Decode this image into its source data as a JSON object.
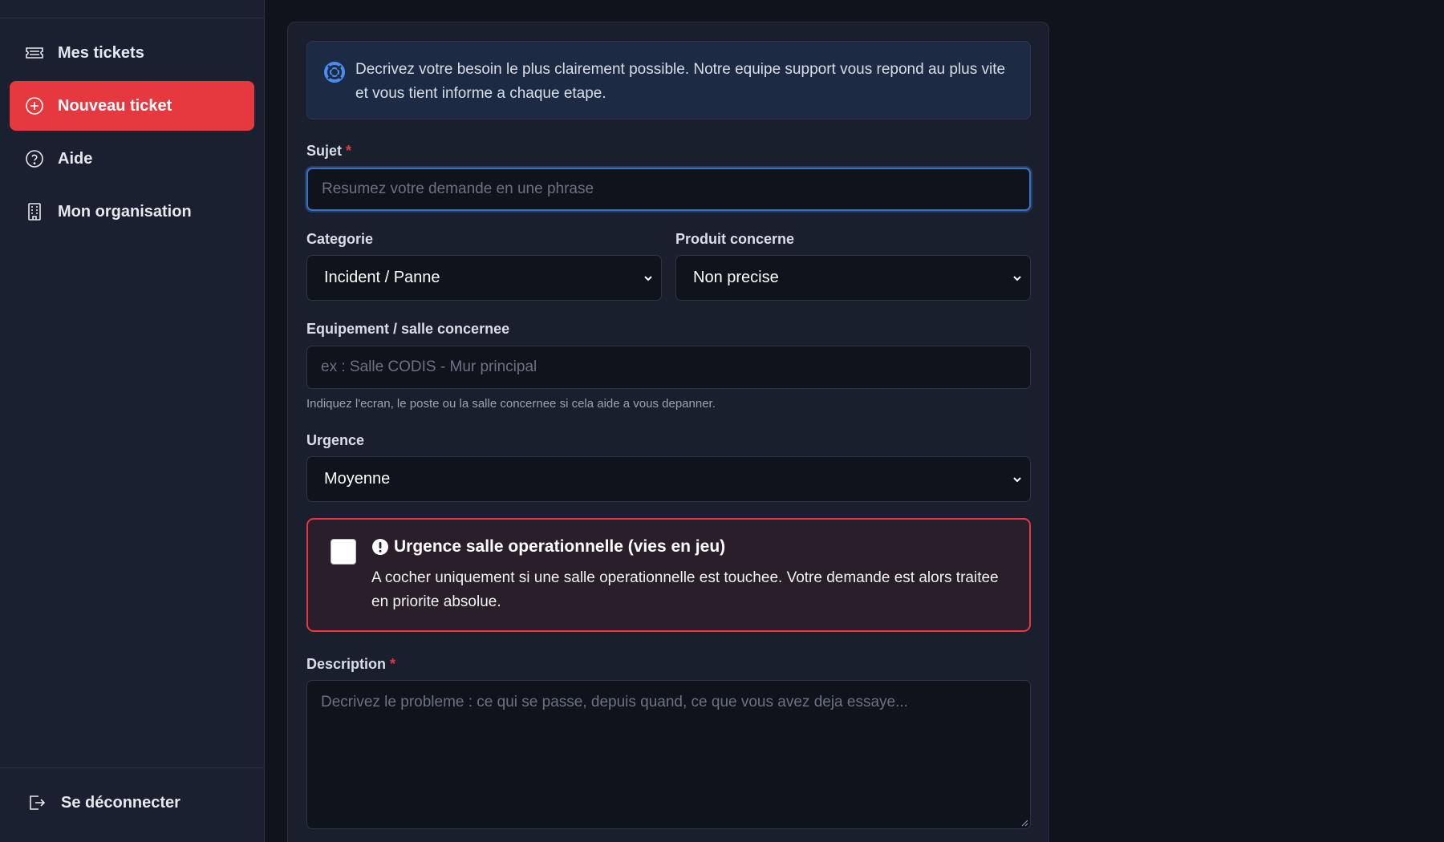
{
  "sidebar": {
    "items": [
      {
        "label": "Mes tickets",
        "icon": "ticket-icon"
      },
      {
        "label": "Nouveau ticket",
        "icon": "plus-circle-icon",
        "active": true
      },
      {
        "label": "Aide",
        "icon": "question-circle-icon"
      },
      {
        "label": "Mon organisation",
        "icon": "building-icon"
      }
    ],
    "logout_label": "Se déconnecter",
    "active_color": "#e5393f"
  },
  "form": {
    "info_text": "Decrivez votre besoin le plus clairement possible. Notre equipe support vous repond au plus vite et vous tient informe a chaque etape.",
    "subject": {
      "label": "Sujet",
      "required_mark": "*",
      "placeholder": "Resumez votre demande en une phrase",
      "value": ""
    },
    "category": {
      "label": "Categorie",
      "selected": "Incident / Panne"
    },
    "product": {
      "label": "Produit concerne",
      "selected": "Non precise"
    },
    "equipment": {
      "label": "Equipement / salle concernee",
      "placeholder": "ex : Salle CODIS - Mur principal",
      "value": "",
      "help": "Indiquez l'ecran, le poste ou la salle concernee si cela aide a vous depanner."
    },
    "urgency": {
      "label": "Urgence",
      "selected": "Moyenne"
    },
    "emergency": {
      "title": "Urgence salle operationnelle (vies en jeu)",
      "body": "A cocher uniquement si une salle operationnelle est touchee. Votre demande est alors traitee en priorite absolue.",
      "checked": false,
      "border_color": "#e5393f"
    },
    "description": {
      "label": "Description",
      "required_mark": "*",
      "placeholder": "Decrivez le probleme : ce qui se passe, depuis quand, ce que vous avez deja essaye...",
      "value": ""
    }
  }
}
